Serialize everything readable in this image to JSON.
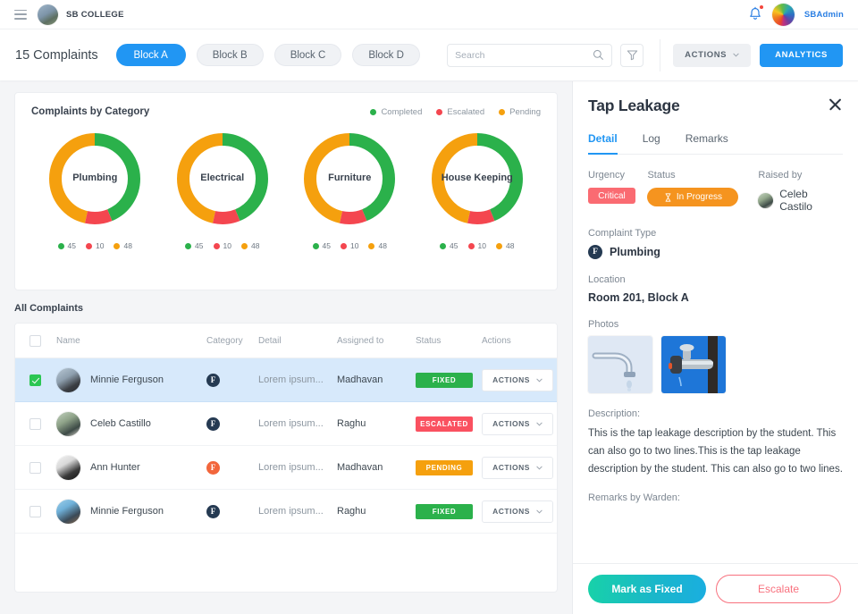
{
  "topbar": {
    "menu_icon": "hamburger-icon",
    "brand": "SB COLLEGE",
    "bell_icon": "bell-icon",
    "user": "SBAdmin"
  },
  "subbar": {
    "count_label": "15 Complaints",
    "blocks": [
      {
        "label": "Block A",
        "active": true
      },
      {
        "label": "Block B",
        "active": false
      },
      {
        "label": "Block C",
        "active": false
      },
      {
        "label": "Block D",
        "active": false
      }
    ],
    "search_placeholder": "Search",
    "search_value": "",
    "search_icon": "search-icon",
    "filter_icon": "filter-icon",
    "actions_label": "ACTIONS",
    "analytics_label": "ANALYTICS"
  },
  "charts": {
    "title": "Complaints by Category",
    "legend": [
      {
        "label": "Completed",
        "color": "#2bb14b"
      },
      {
        "label": "Escalated",
        "color": "#f4464f"
      },
      {
        "label": "Pending",
        "color": "#f5a00e"
      }
    ]
  },
  "chart_data": [
    {
      "type": "pie",
      "title": "Plumbing",
      "categories": [
        "Completed",
        "Escalated",
        "Pending"
      ],
      "values": [
        45,
        10,
        48
      ],
      "colors": [
        "#2bb14b",
        "#f4464f",
        "#f5a00e"
      ],
      "legend_position": "bottom",
      "donut": true
    },
    {
      "type": "pie",
      "title": "Electrical",
      "categories": [
        "Completed",
        "Escalated",
        "Pending"
      ],
      "values": [
        45,
        10,
        48
      ],
      "colors": [
        "#2bb14b",
        "#f4464f",
        "#f5a00e"
      ],
      "legend_position": "bottom",
      "donut": true
    },
    {
      "type": "pie",
      "title": "Furniture",
      "categories": [
        "Completed",
        "Escalated",
        "Pending"
      ],
      "values": [
        45,
        10,
        48
      ],
      "colors": [
        "#2bb14b",
        "#f4464f",
        "#f5a00e"
      ],
      "legend_position": "bottom",
      "donut": true
    },
    {
      "type": "pie",
      "title": "House Keeping",
      "categories": [
        "Completed",
        "Escalated",
        "Pending"
      ],
      "values": [
        45,
        10,
        48
      ],
      "colors": [
        "#2bb14b",
        "#f4464f",
        "#f5a00e"
      ],
      "legend_position": "bottom",
      "donut": true
    }
  ],
  "table": {
    "section_title": "All Complaints",
    "columns": [
      "Name",
      "Category",
      "Detail",
      "Assigned to",
      "Status",
      "Actions"
    ],
    "action_label": "ACTIONS",
    "rows": [
      {
        "checked": true,
        "name": "Minnie Ferguson",
        "category_icon": "F",
        "category_style": "dark",
        "detail": "Lorem ipsum...",
        "assigned_to": "Madhavan",
        "status": "FIXED",
        "status_class": "b-fixed",
        "avatar_class": "av1"
      },
      {
        "checked": false,
        "name": "Celeb Castillo",
        "category_icon": "F",
        "category_style": "dark",
        "detail": "Lorem ipsum...",
        "assigned_to": "Raghu",
        "status": "ESCALATED",
        "status_class": "b-escalated",
        "avatar_class": "av2"
      },
      {
        "checked": false,
        "name": "Ann Hunter",
        "category_icon": "F",
        "category_style": "alt",
        "detail": "Lorem ipsum...",
        "assigned_to": "Madhavan",
        "status": "PENDING",
        "status_class": "b-pending",
        "avatar_class": "av3"
      },
      {
        "checked": false,
        "name": "Minnie Ferguson",
        "category_icon": "F",
        "category_style": "dark",
        "detail": "Lorem ipsum...",
        "assigned_to": "Raghu",
        "status": "FIXED",
        "status_class": "b-fixed",
        "avatar_class": "av4"
      }
    ]
  },
  "panel": {
    "title": "Tap Leakage",
    "close_icon": "close-icon",
    "tabs": [
      {
        "label": "Detail",
        "active": true
      },
      {
        "label": "Log",
        "active": false
      },
      {
        "label": "Remarks",
        "active": false
      }
    ],
    "urgency_label": "Urgency",
    "urgency_value": "Critical",
    "status_label": "Status",
    "status_value": "In Progress",
    "status_icon": "hourglass-icon",
    "raised_by_label": "Raised by",
    "raised_by_value": "Celeb Castilo",
    "complaint_type_label": "Complaint Type",
    "complaint_type_value": "Plumbing",
    "complaint_type_icon": "F",
    "location_label": "Location",
    "location_value": "Room 201, Block A",
    "photos_label": "Photos",
    "photos": [
      {
        "name": "dripping-tap-photo"
      },
      {
        "name": "outdoor-tap-photo"
      }
    ],
    "description_label": "Description:",
    "description_value": "This is the tap leakage description by the student. This can also go to two lines.This is the tap leakage description by the student. This can also go to two lines.",
    "remarks_label": "Remarks by Warden:",
    "primary_button": "Mark as Fixed",
    "secondary_button": "Escalate"
  },
  "colors": {
    "accent": "#2196f3",
    "green": "#2bb14b",
    "red": "#f4464f",
    "orange": "#f5a00e",
    "critical": "#fa6b72",
    "selected_row": "#d7e9fb"
  }
}
